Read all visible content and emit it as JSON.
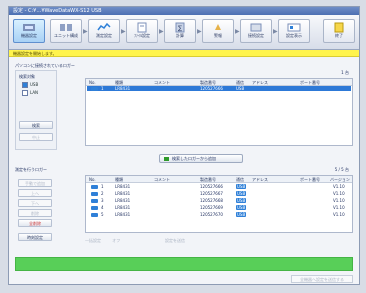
{
  "window": {
    "title": "設定 - C:¥…¥WaveDataWX-S12 USB"
  },
  "toolbar": {
    "buttons": [
      {
        "label": "機器設定",
        "icon": "device-icon",
        "active": true
      },
      {
        "label": "ユニット構成",
        "icon": "unit-icon",
        "active": false
      },
      {
        "label": "測定設定",
        "icon": "measure-icon",
        "active": false
      },
      {
        "label": "ﾌｧｲﾙ設定",
        "icon": "file-icon",
        "active": false
      },
      {
        "label": "計算",
        "icon": "calc-icon",
        "active": false
      },
      {
        "label": "警報",
        "icon": "alarm-icon",
        "active": false
      },
      {
        "label": "接続設定",
        "icon": "link-icon",
        "active": false
      },
      {
        "label": "設定表示",
        "icon": "display-icon",
        "active": false
      },
      {
        "label": "終了",
        "icon": "exit-icon",
        "active": false
      }
    ]
  },
  "status": {
    "text": "機器設定を開始します。"
  },
  "top_section": {
    "title": "パソコンに接続されているロガー",
    "count": "1 台",
    "search_label": "検索対象",
    "checkboxes": [
      {
        "label": "USB",
        "checked": true
      },
      {
        "label": "LAN",
        "checked": false
      }
    ],
    "search_button": "検索",
    "stop_button": "中止",
    "columns": [
      "No.",
      "種類",
      "コメント",
      "製造番号",
      "通信",
      "アドレス",
      "ポート番号"
    ],
    "rows": [
      {
        "no": "1",
        "type": "LR8431",
        "comment": "",
        "serial": "120527666",
        "comm": "USB",
        "address": "",
        "port": ""
      }
    ]
  },
  "add_button": "検索したロガーから追加",
  "bottom_section": {
    "title": "測定を行うロガー",
    "count": "5 / 5 台",
    "buttons": [
      {
        "label": "手動で追加",
        "disabled": true
      },
      {
        "label": "上へ",
        "disabled": true
      },
      {
        "label": "下へ",
        "disabled": true
      },
      {
        "label": "削除",
        "disabled": true
      },
      {
        "label": "全削除",
        "disabled": false,
        "red": true
      },
      {
        "label": "時刻設定",
        "disabled": false
      }
    ],
    "columns": [
      "No.",
      "種類",
      "コメント",
      "製造番号",
      "通信",
      "アドレス",
      "ポート番号",
      "バージョン"
    ],
    "rows": [
      {
        "no": "1",
        "type": "LR8431",
        "comment": "",
        "serial": "120527666",
        "comm": "USB",
        "address": "",
        "port": "",
        "version": "V1.10"
      },
      {
        "no": "2",
        "type": "LR8431",
        "comment": "",
        "serial": "120527667",
        "comm": "USB",
        "address": "",
        "port": "",
        "version": "V1.10"
      },
      {
        "no": "3",
        "type": "LR8431",
        "comment": "",
        "serial": "120527668",
        "comm": "USB",
        "address": "",
        "port": "",
        "version": "V1.10"
      },
      {
        "no": "4",
        "type": "LR8431",
        "comment": "",
        "serial": "120527669",
        "comm": "USB",
        "address": "",
        "port": "",
        "version": "V1.10"
      },
      {
        "no": "5",
        "type": "LR8431",
        "comment": "",
        "serial": "120527670",
        "comm": "USB",
        "address": "",
        "port": "",
        "version": "V1.10"
      }
    ],
    "sub_controls": [
      {
        "label": "一括設定",
        "value": "オフ"
      },
      {
        "label": "設定を送信",
        "value": ""
      }
    ]
  },
  "footer": {
    "button": "全機器へ設定を送信する"
  },
  "colors": {
    "accent": "#2f80d8",
    "status_bg": "#fff44d",
    "footer_green": "#58cf58"
  }
}
